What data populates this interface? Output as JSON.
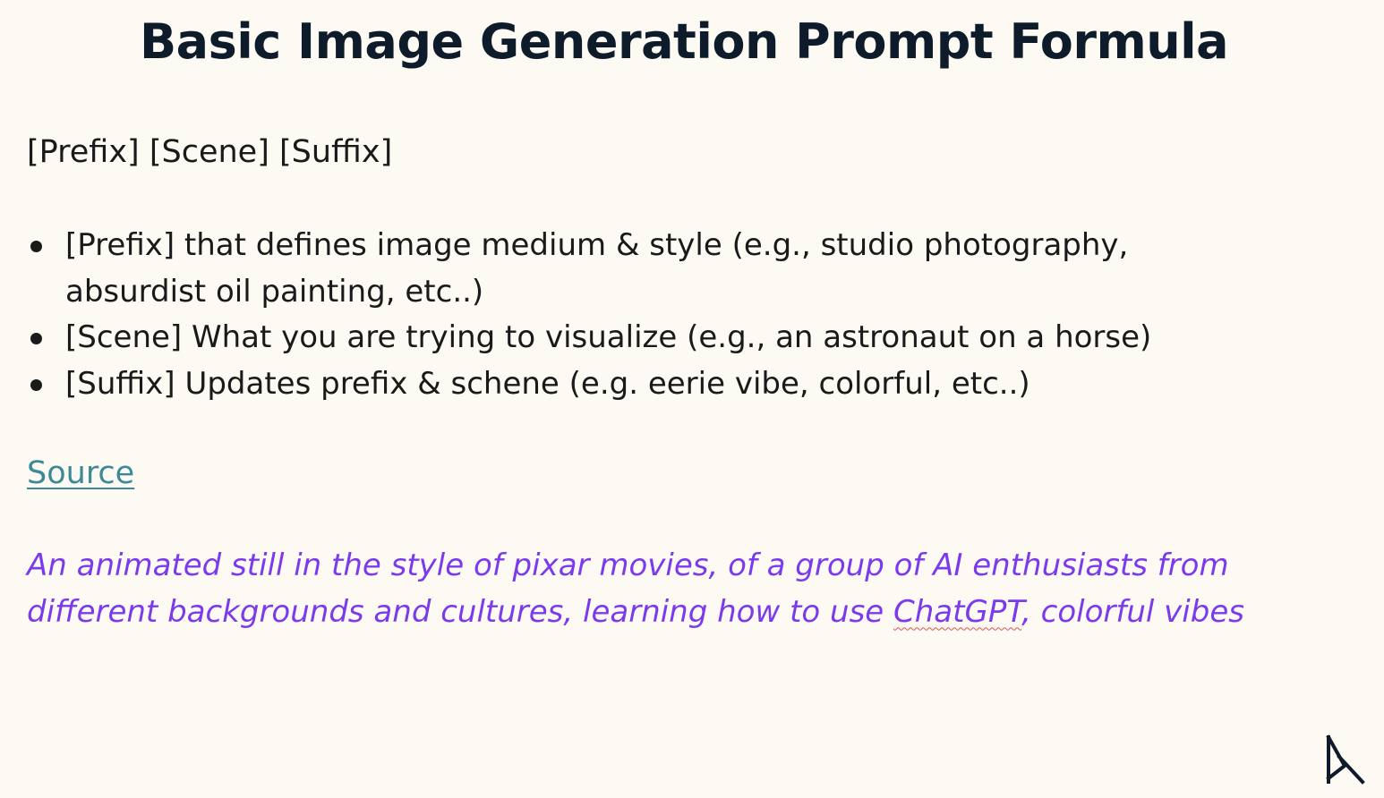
{
  "title": "Basic Image Generation Prompt Formula",
  "formula": "[Prefix] [Scene] [Suffix]",
  "bullets": [
    {
      "text": "[Prefix] that defines image medium & style (e.g., studio photography, absurdist oil painting, etc..)"
    },
    {
      "text": "[Scene] What you are trying to visualize (e.g., an astronaut on a horse)"
    },
    {
      "text": "[Suffix] Updates prefix & schene (e.g. eerie vibe, colorful, etc..)"
    }
  ],
  "source_link": "Source",
  "example_prompt": {
    "before": "An animated still in the style of pixar movies, of a group of AI enthusiasts from different backgrounds and cultures, learning how to use ",
    "flagged_word": "ChatGPT",
    "after": ", colorful vibes"
  },
  "logo_icon": "brand-logo-icon",
  "colors": {
    "background": "#fdfaf3",
    "title": "#0d1b2a",
    "link": "#3d8a96",
    "example_text": "#7c3aed"
  }
}
